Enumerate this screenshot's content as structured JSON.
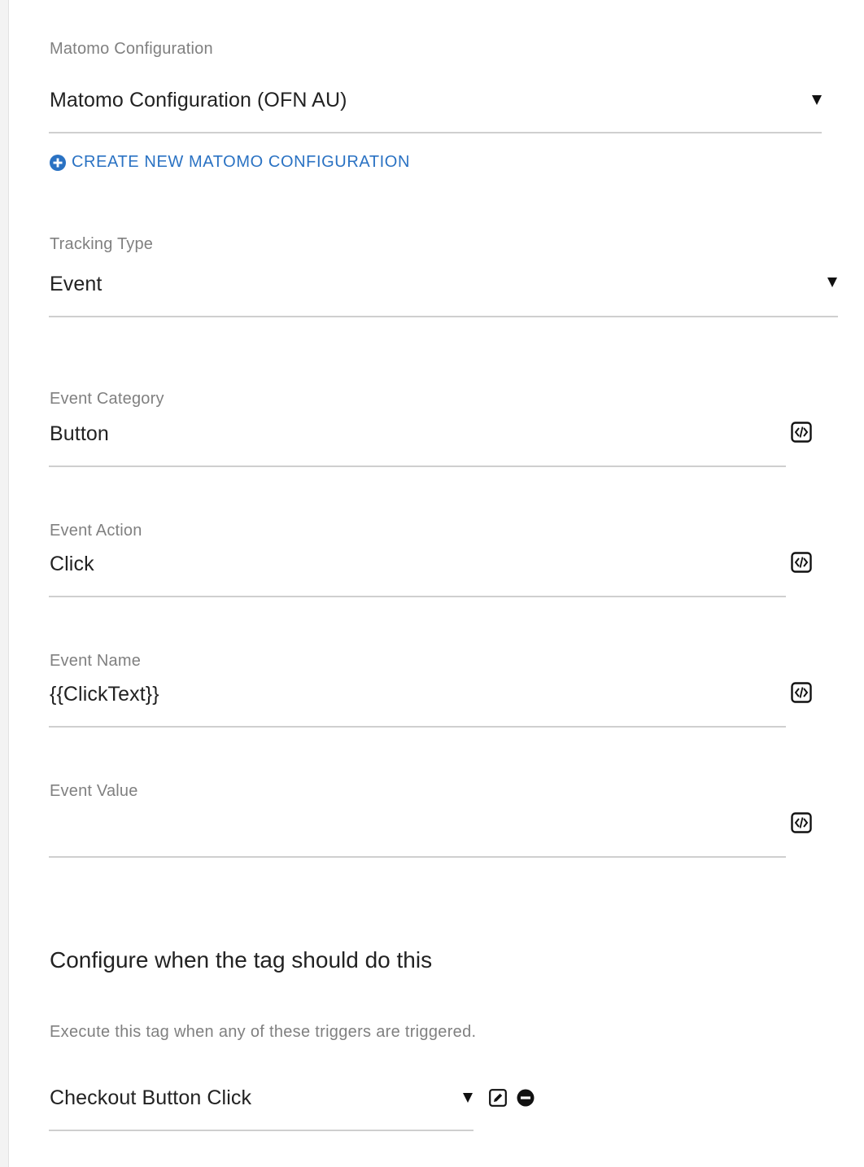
{
  "matomo": {
    "label": "Matomo Configuration",
    "value": "Matomo Configuration (OFN AU)",
    "create_link": "CREATE NEW MATOMO CONFIGURATION"
  },
  "tracking": {
    "label": "Tracking Type",
    "value": "Event"
  },
  "event_category": {
    "label": "Event Category",
    "value": "Button"
  },
  "event_action": {
    "label": "Event Action",
    "value": "Click"
  },
  "event_name": {
    "label": "Event Name",
    "value": "{{ClickText}}"
  },
  "event_value": {
    "label": "Event Value",
    "value": ""
  },
  "triggers": {
    "title": "Configure when the tag should do this",
    "help": "Execute this tag when any of these triggers are triggered.",
    "selected": "Checkout Button Click"
  },
  "colors": {
    "link": "#2a72c3",
    "label": "#808080",
    "text": "#222222",
    "line": "#cfcfcf"
  },
  "icons": {
    "variable": "variable-insert-icon",
    "create": "plus-circle-icon",
    "edit": "edit-icon",
    "remove": "minus-circle-icon",
    "dropdown": "caret-down-icon"
  }
}
